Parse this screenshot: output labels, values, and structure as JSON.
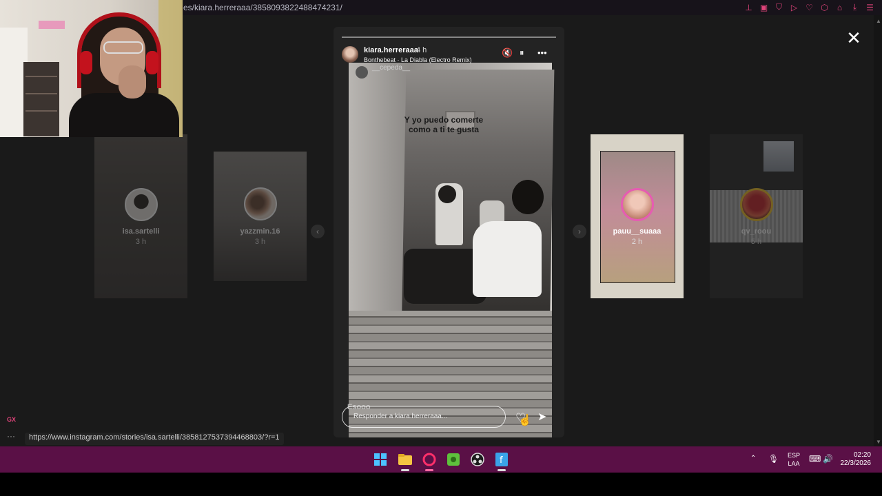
{
  "browser": {
    "url": "es/kiara.herreraaa/3858093822488474231/",
    "status_url": "https://www.instagram.com/stories/isa.sartelli/3858127537394468803/?r=1",
    "sidebar_badge": "GX",
    "sidebar_more": "···"
  },
  "viewer": {
    "close_label": "✕",
    "prev_arrow": "‹",
    "next_arrow": "›"
  },
  "thumbnails": [
    {
      "username": "isa.sartelli",
      "time": "3 h"
    },
    {
      "username": "yazzmin.16",
      "time": "3 h"
    },
    {
      "username": "pauu__suaaa",
      "time": "2 h"
    },
    {
      "username": "qv_roou",
      "time": "5 h"
    }
  ],
  "story": {
    "username": "kiara.herreraaa",
    "time": "4 h",
    "music": "Bonthebeat · La Diabla (Electro Remix)",
    "mention": "__cepeda__",
    "caption": "Y yo puedo comerte como a ti te gusta",
    "sticker_text": "Esooo",
    "reply_placeholder": "Responder a kiara.herreraaa...",
    "mute_icon": "🔇",
    "pause_icon": "⏸",
    "more_icon": "•••",
    "heart_icon": "♡",
    "send_icon": "➤"
  },
  "taskbar": {
    "language_line1": "ESP",
    "language_line2": "LAA",
    "time": "02:20",
    "date": "22/3/2026"
  },
  "colors": {
    "accent": "#e0447a",
    "taskbar": "#5a1046",
    "background": "#1a1a1a"
  }
}
